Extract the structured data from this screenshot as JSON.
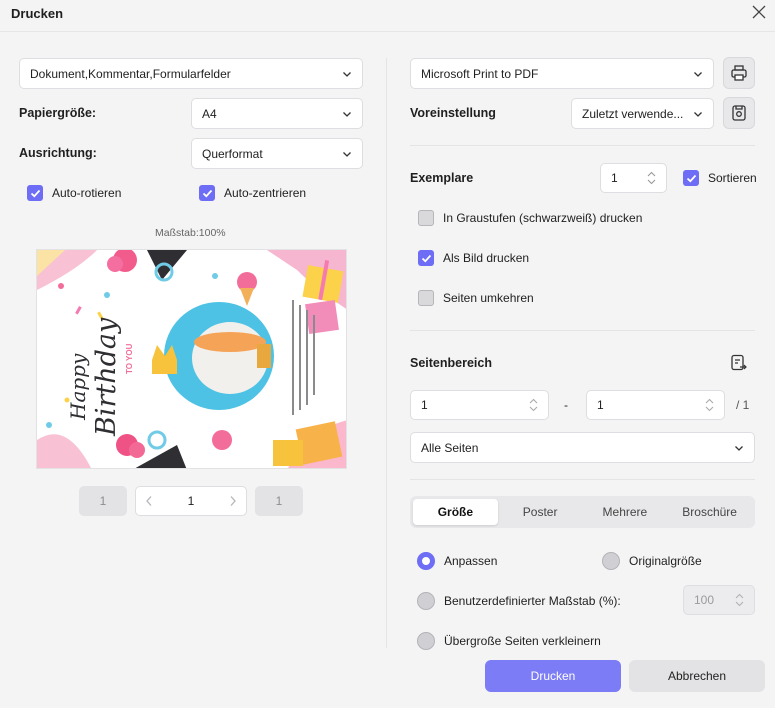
{
  "window": {
    "title": "Drucken"
  },
  "left": {
    "content_select": "Dokument,Kommentar,Formularfelder",
    "paper_size_label": "Papiergröße:",
    "paper_size_value": "A4",
    "orientation_label": "Ausrichtung:",
    "orientation_value": "Querformat",
    "auto_rotate_label": "Auto-rotieren",
    "auto_center_label": "Auto-zentrieren",
    "scale_text": "Maßstab:100%",
    "preview_text": {
      "happy": "Happy",
      "birthday": "Birthday",
      "to_you": "TO YOU"
    },
    "pager": {
      "first": "1",
      "current": "1",
      "last": "1"
    }
  },
  "right": {
    "printer_value": "Microsoft Print to PDF",
    "preset_label": "Voreinstellung",
    "preset_value": "Zuletzt verwende...",
    "copies_label": "Exemplare",
    "copies_value": "1",
    "sort_label": "Sortieren",
    "grayscale_label": "In Graustufen (schwarzweiß) drucken",
    "as_image_label": "Als Bild drucken",
    "reverse_label": "Seiten umkehren",
    "page_range_label": "Seitenbereich",
    "range_from": "1",
    "range_dash": "-",
    "range_to": "1",
    "range_total": "/ 1",
    "pages_select": "Alle Seiten",
    "tabs": [
      "Größe",
      "Poster",
      "Mehrere",
      "Broschüre"
    ],
    "fit_label": "Anpassen",
    "original_label": "Originalgröße",
    "custom_scale_label": "Benutzerdefinierter Maßstab (%):",
    "custom_scale_value": "100",
    "shrink_label": "Übergroße Seiten verkleinern"
  },
  "buttons": {
    "print": "Drucken",
    "cancel": "Abbrechen"
  },
  "colors": {
    "accent": "#6d6df5",
    "primary_button": "#7c7cf6"
  }
}
